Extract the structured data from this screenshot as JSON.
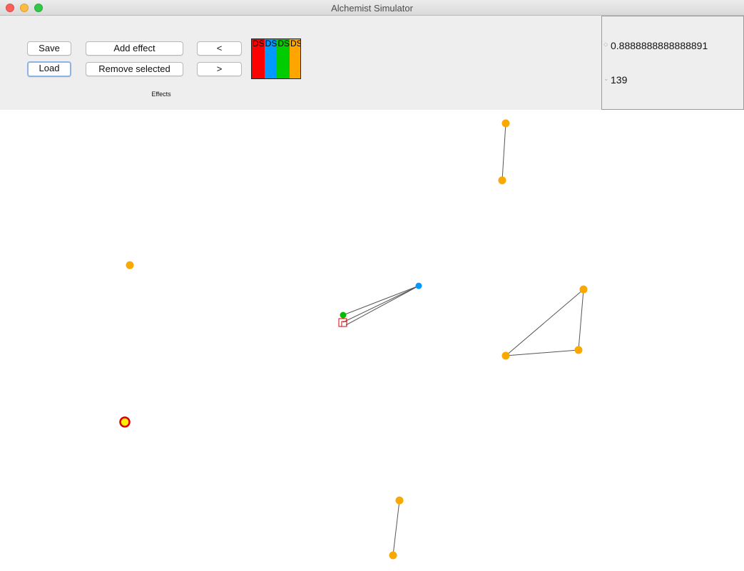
{
  "window": {
    "title": "Alchemist Simulator"
  },
  "toolbar": {
    "save_label": "Save",
    "load_label": "Load",
    "add_effect_label": "Add effect",
    "remove_selected_label": "Remove selected",
    "prev_label": "<",
    "next_label": ">",
    "effects_label": "Effects"
  },
  "effect_preview": {
    "stripes": [
      {
        "color": "#ff0000",
        "text": "DS"
      },
      {
        "color": "#0099ff",
        "text": "DS"
      },
      {
        "color": "#00cc00",
        "text": "DS"
      },
      {
        "color": "#ffa500",
        "text": "DS"
      }
    ]
  },
  "side_panel": {
    "value_1": "0.8888888888888891",
    "value_2": "139"
  },
  "colors": {
    "node_orange": "#f9a800",
    "node_blue": "#0099ff",
    "node_green": "#00bb00",
    "selection_red": "#dd0000",
    "highlight_yellow": "#ffee00"
  }
}
